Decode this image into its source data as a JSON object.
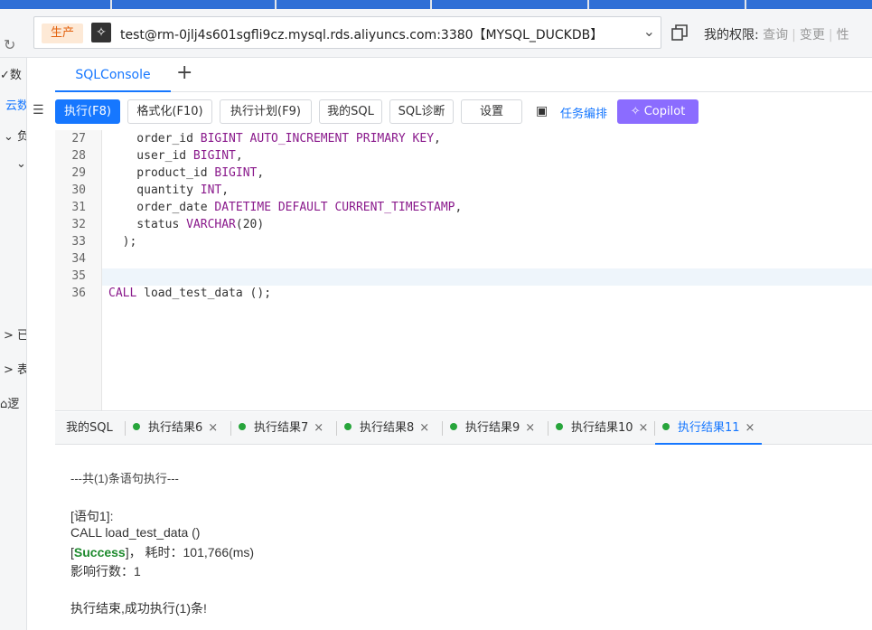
{
  "connection": {
    "env_tag": "生产",
    "text": "test@rm-0jlj4s601sgfli9cz.mysql.rds.aliyuncs.com:3380【MYSQL_DUCKDB】",
    "permissions_label": "我的权限:",
    "perm_query": "查询",
    "perm_change": "变更",
    "perm_perf": "性"
  },
  "left_panel": {
    "item1": "数",
    "item2": "云数",
    "item3": "负",
    "item4": "已",
    "item5": "表",
    "item6": "逻"
  },
  "tabs": {
    "sql_console": "SQLConsole",
    "add": "+"
  },
  "toolbar": {
    "execute": "执行(F8)",
    "format": "格式化(F10)",
    "plan": "执行计划(F9)",
    "my_sql": "我的SQL",
    "diagnose": "SQL诊断",
    "settings": "设置",
    "task_schedule": "任务编排",
    "copilot": "Copilot"
  },
  "editor": {
    "line_numbers": [
      "27",
      "28",
      "29",
      "30",
      "31",
      "32",
      "33",
      "34",
      "35",
      "36"
    ],
    "lines": [
      {
        "indent": "    ",
        "id": "order_id ",
        "kw": "BIGINT AUTO_INCREMENT PRIMARY KEY",
        "tail": ","
      },
      {
        "indent": "    ",
        "id": "user_id ",
        "kw": "BIGINT",
        "tail": ","
      },
      {
        "indent": "    ",
        "id": "product_id ",
        "kw": "BIGINT",
        "tail": ","
      },
      {
        "indent": "    ",
        "id": "quantity ",
        "kw": "INT",
        "tail": ","
      },
      {
        "indent": "    ",
        "id": "order_date ",
        "kw": "DATETIME DEFAULT CURRENT_TIMESTAMP",
        "tail": ","
      },
      {
        "indent": "    ",
        "id": "status ",
        "kw": "VARCHAR",
        "tail": "(20)"
      },
      {
        "indent": "  ",
        "id": ");",
        "kw": "",
        "tail": ""
      },
      {
        "indent": "",
        "id": "",
        "kw": "",
        "tail": ""
      },
      {
        "indent": "",
        "id": "",
        "kw": "",
        "tail": ""
      },
      {
        "indent": "",
        "id": "",
        "kw": "CALL",
        "tail": " load_test_data ();"
      }
    ]
  },
  "result_tabs": [
    {
      "label": "我的SQL"
    },
    {
      "label": "执行结果6"
    },
    {
      "label": "执行结果7"
    },
    {
      "label": "执行结果8"
    },
    {
      "label": "执行结果9"
    },
    {
      "label": "执行结果10"
    },
    {
      "label": "执行结果11"
    }
  ],
  "output": {
    "header": "---共(1)条语句执行---",
    "stmt_label": "[语句1]:",
    "stmt_sql": "CALL load_test_data ()",
    "status_open": "[",
    "status_word": "Success",
    "status_close": "]",
    "elapsed": "，  耗时：101,766(ms)",
    "affected": "影响行数：1",
    "summary": "执行结束,成功执行(1)条!"
  },
  "colors": {
    "accent": "#1677ff",
    "success": "#27a53b",
    "keyword": "#8a1a8c",
    "copilot": "#8b6cff"
  }
}
